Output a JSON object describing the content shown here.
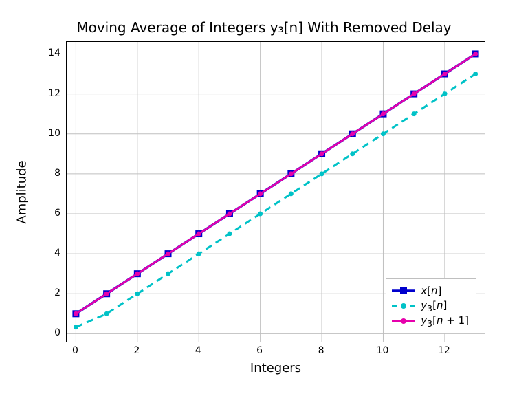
{
  "chart_data": {
    "type": "line",
    "title": "Moving Average of Integers y₃[n] With Removed Delay",
    "xlabel": "Integers",
    "ylabel": "Amplitude",
    "xlim": [
      -0.3,
      13.3
    ],
    "ylim": [
      -0.4,
      14.6
    ],
    "xticks": [
      0,
      2,
      4,
      6,
      8,
      10,
      12
    ],
    "yticks": [
      0,
      2,
      4,
      6,
      8,
      10,
      12,
      14
    ],
    "grid": true,
    "legend_position": "lower right",
    "x": [
      0,
      1,
      2,
      3,
      4,
      5,
      6,
      7,
      8,
      9,
      10,
      11,
      12,
      13
    ],
    "series": [
      {
        "name": "x[n]",
        "label_html": "<i>x</i>[<i>n</i>]",
        "color": "#0000cd",
        "linestyle": "solid",
        "linewidth": 3.5,
        "marker": "square",
        "markersize": 10,
        "values": [
          1,
          2,
          3,
          4,
          5,
          6,
          7,
          8,
          9,
          10,
          11,
          12,
          13,
          14
        ]
      },
      {
        "name": "y3[n]",
        "label_html": "<i>y</i><sub>3</sub>[<i>n</i>]",
        "color": "#00c2c7",
        "linestyle": "dashed",
        "linewidth": 3,
        "marker": "circle",
        "markersize": 7,
        "values": [
          0.33,
          1,
          2,
          3,
          4,
          5,
          6,
          7,
          8,
          9,
          10,
          11,
          12,
          13
        ]
      },
      {
        "name": "y3[n+1]",
        "label_html": "<i>y</i><sub>3</sub>[<i>n</i> + 1]",
        "color": "#e600ac",
        "linestyle": "solid",
        "linewidth": 2.8,
        "marker": "circle",
        "markersize": 7,
        "values": [
          1,
          2,
          3,
          4,
          5,
          6,
          7,
          8,
          9,
          10,
          11,
          12,
          13,
          14
        ]
      }
    ]
  }
}
